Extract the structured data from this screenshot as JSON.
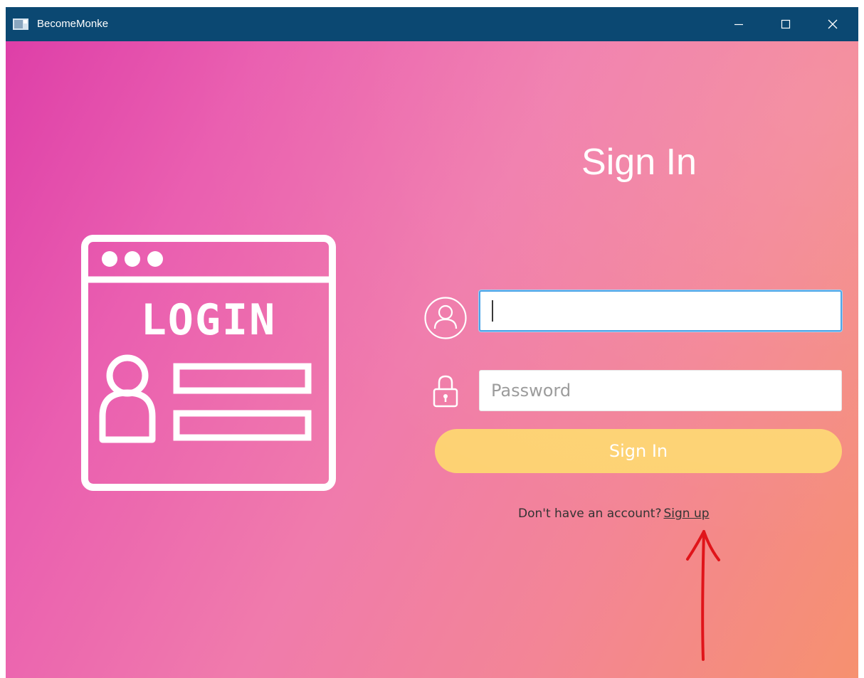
{
  "window": {
    "title": "BecomeMonke",
    "controls": {
      "minimize_icon": "minimize-icon",
      "maximize_icon": "maximize-icon",
      "close_icon": "close-icon"
    }
  },
  "illustration": {
    "text": "LOGIN",
    "icon": "login-window-illustration"
  },
  "form": {
    "heading": "Sign In",
    "username": {
      "icon": "user-circle-icon",
      "value": "",
      "placeholder": ""
    },
    "password": {
      "icon": "lock-icon",
      "value": "",
      "placeholder": "Password"
    },
    "submit_label": "Sign In",
    "signup_prompt": "Don't have an account?",
    "signup_link": "Sign up"
  },
  "annotation": {
    "icon": "red-hand-drawn-arrow",
    "color": "#e0141a"
  },
  "colors": {
    "titlebar": "#0b4872",
    "gradient_start": "#de3fa8",
    "gradient_end": "#f6916f",
    "button": "#fdd273",
    "focus_border": "#45a0e6"
  }
}
